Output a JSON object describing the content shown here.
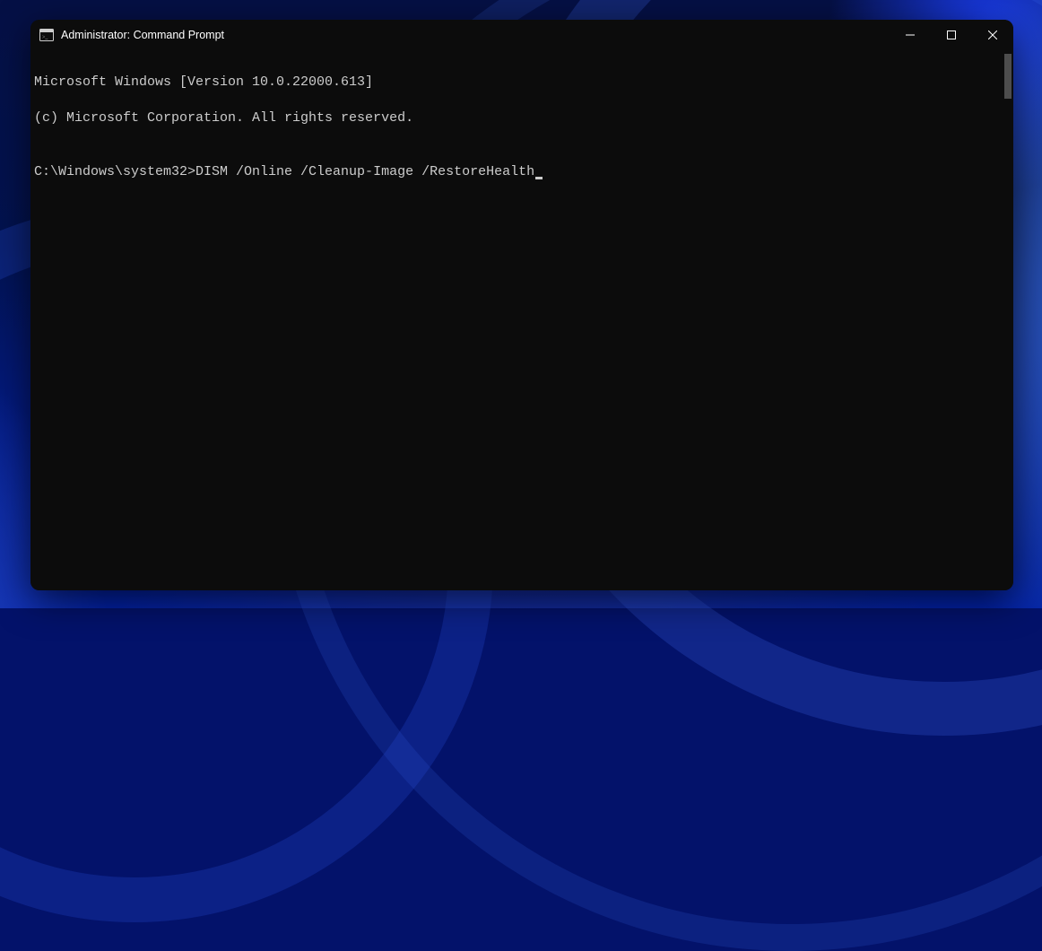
{
  "window": {
    "title": "Administrator: Command Prompt"
  },
  "terminal": {
    "line1": "Microsoft Windows [Version 10.0.22000.613]",
    "line2": "(c) Microsoft Corporation. All rights reserved.",
    "blank": "",
    "prompt_path": "C:\\Windows\\system32>",
    "command": "DISM /Online /Cleanup-Image /RestoreHealth"
  }
}
